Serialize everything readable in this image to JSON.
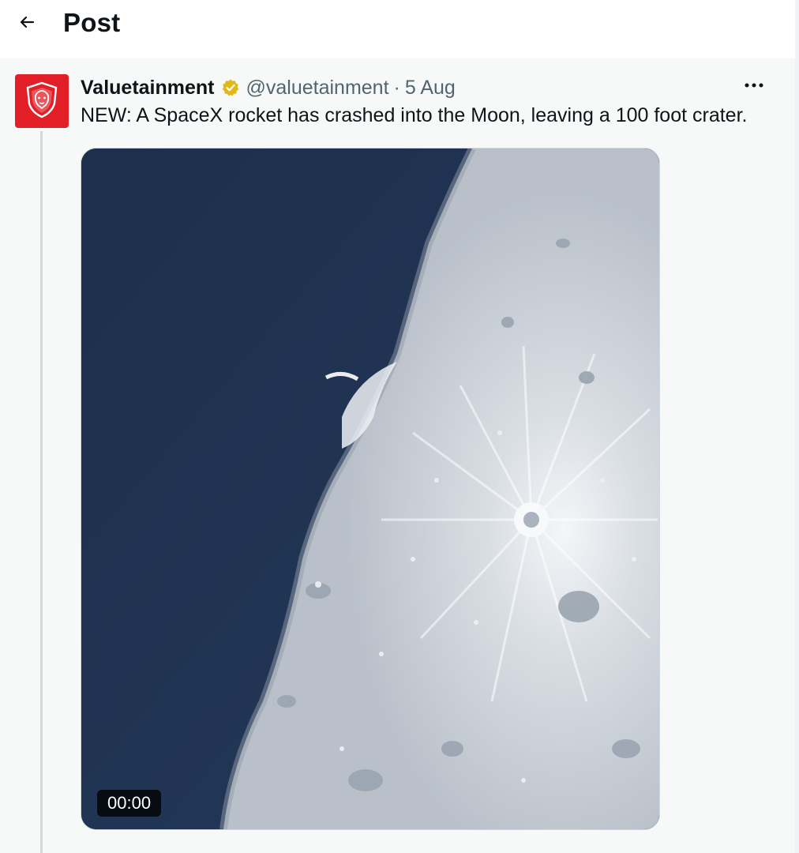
{
  "header": {
    "back_icon": "arrow-left-icon",
    "title": "Post"
  },
  "post": {
    "author": {
      "display_name": "Valuetainment",
      "verified_icon": "verified-badge-icon",
      "verified_color": "#e2b719",
      "handle": "@valuetainment",
      "separator": "·",
      "timestamp": "5 Aug",
      "avatar_icon": "lion-shield-logo-icon",
      "avatar_color": "#e21f26"
    },
    "more_icon": "more-horizontal-icon",
    "text": "NEW: A SpaceX rocket has crashed into the Moon, leaving a 100 foot crater.",
    "media": {
      "type": "video",
      "duration": "00:00"
    }
  },
  "colors": {
    "text_primary": "#0f1419",
    "text_secondary": "#536471",
    "post_background": "#f7f9f9",
    "space_blue": "#1e3351"
  }
}
